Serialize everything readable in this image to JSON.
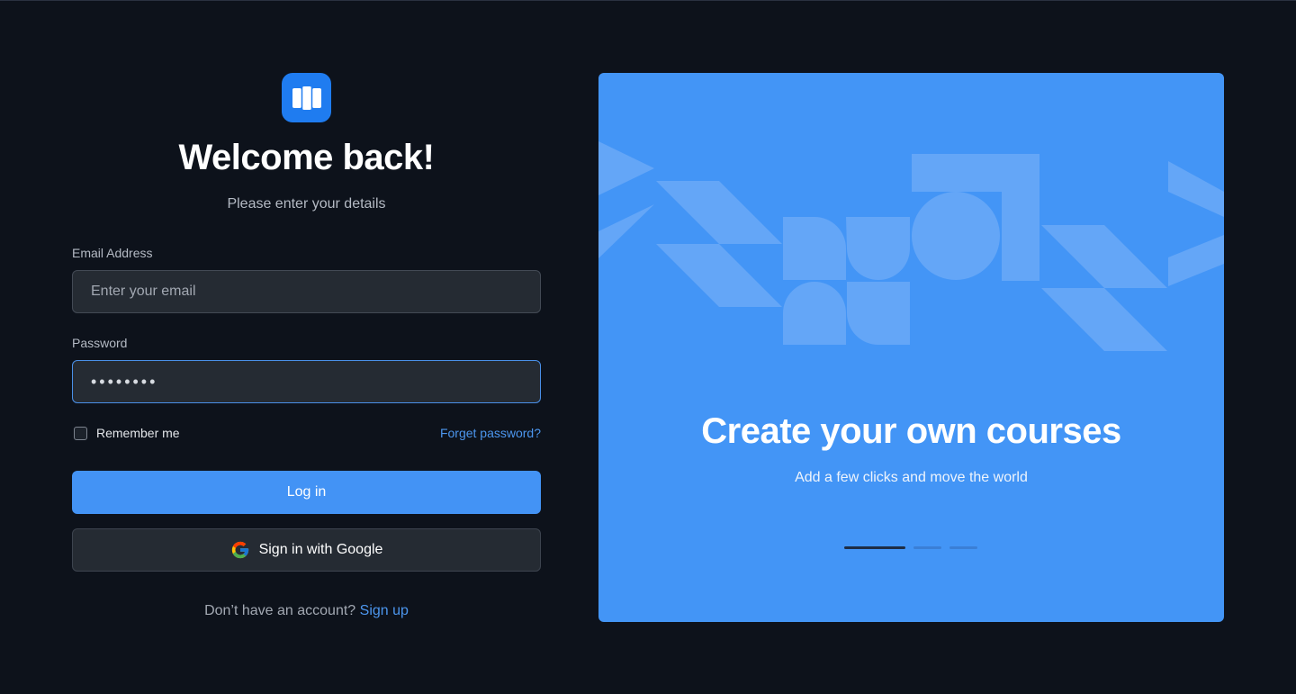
{
  "login": {
    "title": "Welcome back!",
    "subtitle": "Please enter your details",
    "email_label": "Email Address",
    "email_placeholder": "Enter your email",
    "password_label": "Password",
    "password_value": "••••••••",
    "remember_label": "Remember me",
    "forgot_label": "Forget password?",
    "login_button": "Log in",
    "google_button": "Sign in with Google",
    "signup_prompt": "Don’t have an account?",
    "signup_link": "Sign up"
  },
  "promo": {
    "title": "Create your own courses",
    "subtitle": "Add a few clicks and move the world",
    "slides": 3,
    "active_slide": 1
  },
  "icons": {
    "logo": "book-logo-icon",
    "google": "google-icon"
  },
  "colors": {
    "background": "#0d121b",
    "accent": "#4393f5",
    "panel": "#4395f6",
    "link": "#4c96ee"
  }
}
